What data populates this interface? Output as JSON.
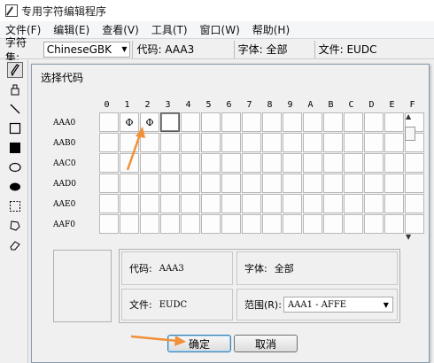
{
  "window": {
    "title": "专用字符编辑程序"
  },
  "menu": [
    "文件(F)",
    "编辑(E)",
    "查看(V)",
    "工具(T)",
    "窗口(W)",
    "帮助(H)"
  ],
  "infobar": {
    "charset_label": "字符集:",
    "charset_value": "ChineseGBK",
    "code": "代码: AAA3",
    "font": "字体: 全部",
    "file": "文件: EUDC"
  },
  "tools": [
    "pencil-icon",
    "brush-icon",
    "line-icon",
    "hollow-rectangle-icon",
    "filled-rectangle-icon",
    "hollow-ellipse-icon",
    "filled-ellipse-icon",
    "rectangular-select-icon",
    "freeform-select-icon",
    "eraser-icon"
  ],
  "dialog": {
    "title": "选择代码",
    "columns": [
      "0",
      "1",
      "2",
      "3",
      "4",
      "5",
      "6",
      "7",
      "8",
      "9",
      "A",
      "B",
      "C",
      "D",
      "E",
      "F"
    ],
    "rows": [
      "AAA0",
      "AAB0",
      "AAC0",
      "AAD0",
      "AAE0",
      "AAF0"
    ],
    "cells_row0": [
      "",
      "Φ",
      "Φ"
    ],
    "selected_cell": "AAA3",
    "code_label": "代码:",
    "code_value": "AAA3",
    "font_label": "字体:",
    "font_value": "全部",
    "file_label": "文件:",
    "file_value": "EUDC",
    "range_label": "范围(R):",
    "range_value": "AAA1 - AFFE",
    "ok_button": "确定",
    "cancel_button": "取消"
  },
  "colors": {
    "annotation_arrow": "#f0913a",
    "selection_border": "#555555"
  }
}
